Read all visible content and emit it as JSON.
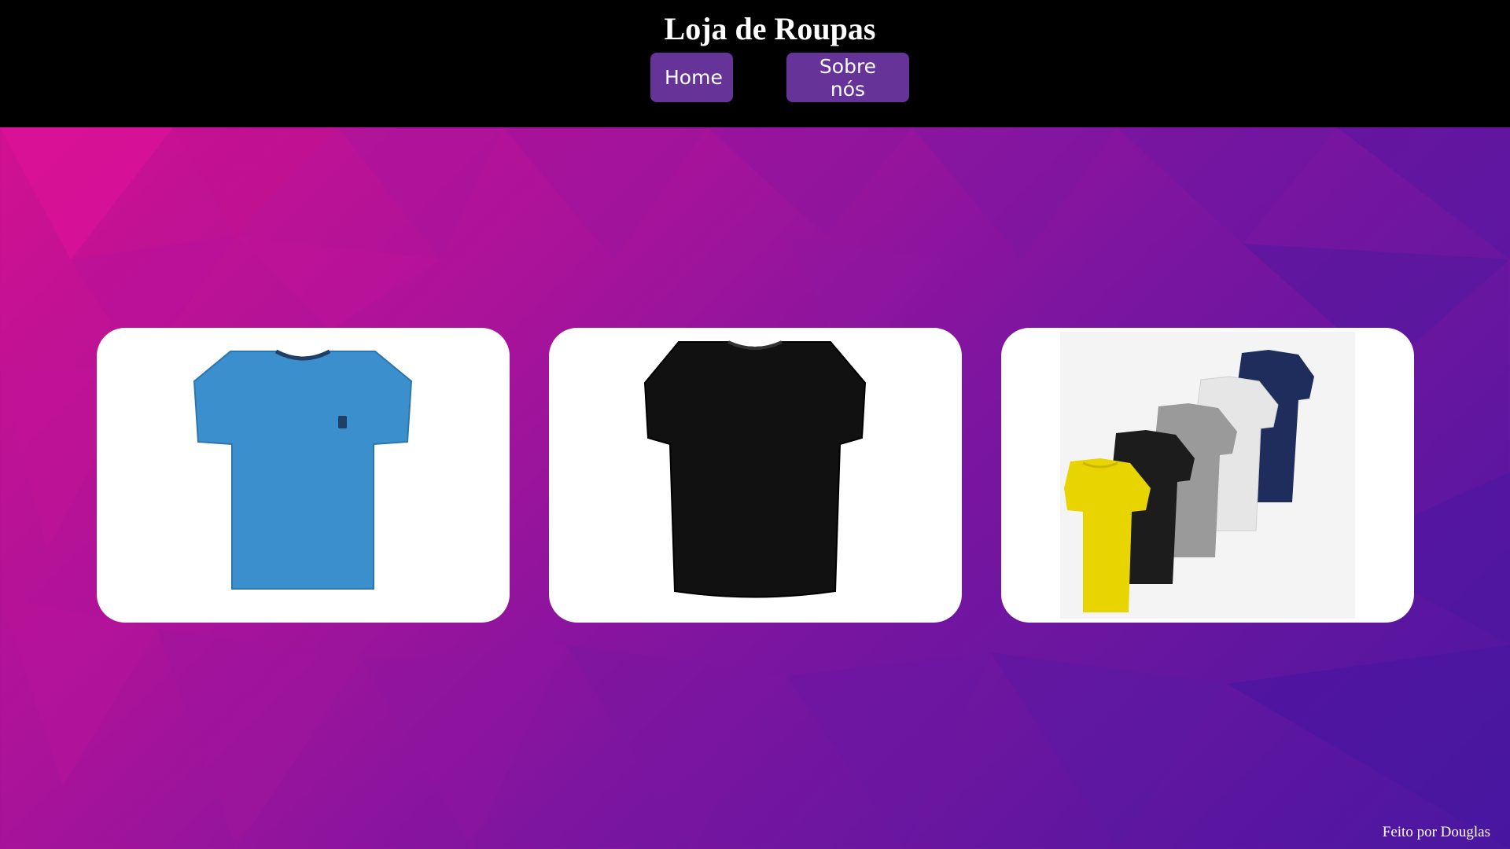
{
  "header": {
    "title": "Loja de Roupas",
    "nav": {
      "home_label": "Home",
      "about_label": "Sobre nós"
    }
  },
  "products": [
    {
      "icon": "blue-tshirt-image",
      "color": "#3a8fcc"
    },
    {
      "icon": "black-tshirt-image",
      "color": "#111111"
    },
    {
      "icon": "tshirt-pack-image",
      "colors": [
        "#e8d400",
        "#1c1c1c",
        "#9a9a9a",
        "#e6e6e6",
        "#1f2d5c"
      ]
    }
  ],
  "footer": {
    "credit": "Feito por Douglas"
  },
  "colors": {
    "header_bg": "#000000",
    "nav_button_bg": "#663399",
    "bg_pink": "#d8108f",
    "bg_purple": "#4a17a0"
  }
}
